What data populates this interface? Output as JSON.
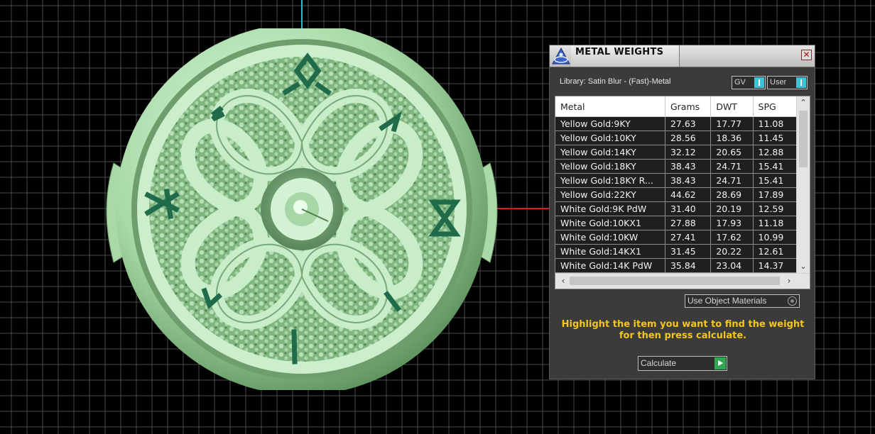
{
  "panel": {
    "title": "METAL WEIGHTS",
    "close_glyph": "✕",
    "library_label": "Library: Satin Blur - (Fast)-Metal",
    "toggles": {
      "gv_label": "GV",
      "user_label": "User"
    },
    "table": {
      "headers": [
        "Metal",
        "Grams",
        "DWT",
        "SPG"
      ],
      "rows": [
        [
          "Yellow Gold:9KY",
          "27.63",
          "17.77",
          "11.08"
        ],
        [
          "Yellow Gold:10KY",
          "28.56",
          "18.36",
          "11.45"
        ],
        [
          "Yellow Gold:14KY",
          "32.12",
          "20.65",
          "12.88"
        ],
        [
          "Yellow Gold:18KY",
          "38.43",
          "24.71",
          "15.41"
        ],
        [
          "Yellow Gold:18KY R...",
          "38.43",
          "24.71",
          "15.41"
        ],
        [
          "Yellow Gold:22KY",
          "44.62",
          "28.69",
          "17.89"
        ],
        [
          "White Gold:9K PdW",
          "31.40",
          "20.19",
          "12.59"
        ],
        [
          "White Gold:10KX1",
          "27.88",
          "17.93",
          "11.18"
        ],
        [
          "White Gold:10KW",
          "27.41",
          "17.62",
          "10.99"
        ],
        [
          "White Gold:14KX1",
          "31.45",
          "20.22",
          "12.61"
        ],
        [
          "White Gold:14K PdW",
          "35.84",
          "23.04",
          "14.37"
        ]
      ]
    },
    "use_object_materials_label": "Use Object Materials",
    "instruction": "Highlight the item you want to find the weight for then press calculate.",
    "calculate_label": "Calculate"
  },
  "colors": {
    "viewport_bg": "#000000",
    "grid_line": "#4a4a4a",
    "model_green": "#b8e6b8",
    "rune_green": "#1f6b4a",
    "instruction_text": "#f5c518",
    "toggle_knob": "#3ec2d8",
    "calculate_go": "#2fa84f"
  }
}
